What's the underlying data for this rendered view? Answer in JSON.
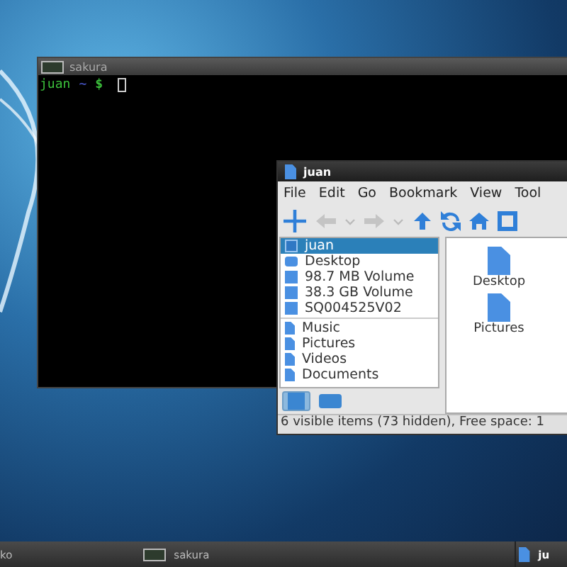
{
  "terminal": {
    "title": "sakura",
    "prompt_user": "juan",
    "prompt_path": "~",
    "prompt_sign": "$"
  },
  "file_manager": {
    "title": "juan",
    "menu": [
      "File",
      "Edit",
      "Go",
      "Bookmark",
      "View",
      "Tool"
    ],
    "toolbar": [
      {
        "kind": "new",
        "disabled": false
      },
      {
        "kind": "back",
        "disabled": true
      },
      {
        "kind": "caret",
        "disabled": true
      },
      {
        "kind": "forward",
        "disabled": true
      },
      {
        "kind": "caret",
        "disabled": true
      },
      {
        "kind": "up",
        "disabled": false
      },
      {
        "kind": "reload",
        "disabled": false
      },
      {
        "kind": "home",
        "disabled": false
      },
      {
        "kind": "view",
        "disabled": false
      }
    ],
    "places": [
      {
        "label": "juan",
        "kind": "home",
        "selected": true
      },
      {
        "label": "Desktop",
        "kind": "desktop",
        "selected": false
      },
      {
        "label": "98.7 MB Volume",
        "kind": "drive",
        "selected": false
      },
      {
        "label": "38.3 GB Volume",
        "kind": "drive",
        "selected": false
      },
      {
        "label": "SQ004525V02",
        "kind": "drive",
        "selected": false
      }
    ],
    "bookmarks": [
      {
        "label": "Music",
        "selected": false
      },
      {
        "label": "Pictures",
        "selected": false
      },
      {
        "label": "Videos",
        "selected": false
      },
      {
        "label": "Documents",
        "selected": false
      }
    ],
    "pane_buttons": [
      {
        "kind": "places",
        "selected": true
      },
      {
        "kind": "tree",
        "selected": false
      }
    ],
    "files": [
      {
        "label": "Desktop"
      },
      {
        "label": "Pictures"
      }
    ],
    "status_bar": "6 visible items (73 hidden), Free space: 1"
  },
  "taskbar": {
    "left_label": "ko",
    "tasks": [
      {
        "label": "sakura",
        "kind": "terminal"
      },
      {
        "label": "ju",
        "kind": "folder"
      }
    ]
  }
}
